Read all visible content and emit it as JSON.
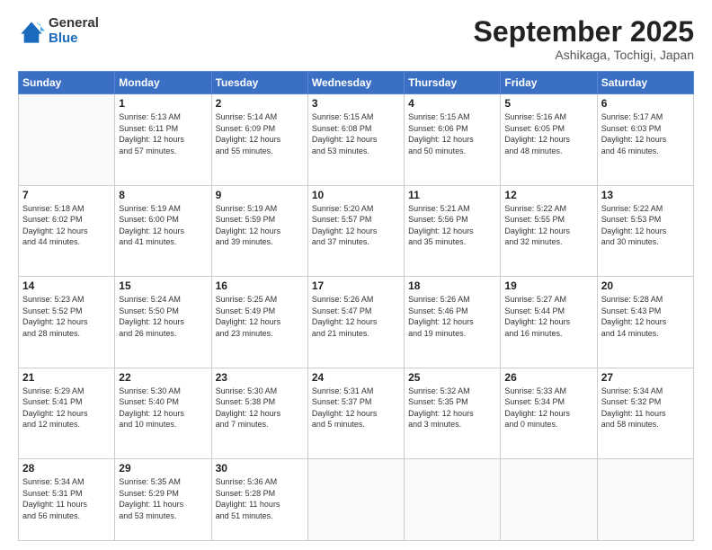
{
  "logo": {
    "general": "General",
    "blue": "Blue"
  },
  "header": {
    "month": "September 2025",
    "location": "Ashikaga, Tochigi, Japan"
  },
  "weekdays": [
    "Sunday",
    "Monday",
    "Tuesday",
    "Wednesday",
    "Thursday",
    "Friday",
    "Saturday"
  ],
  "weeks": [
    [
      {
        "day": "",
        "info": ""
      },
      {
        "day": "1",
        "info": "Sunrise: 5:13 AM\nSunset: 6:11 PM\nDaylight: 12 hours\nand 57 minutes."
      },
      {
        "day": "2",
        "info": "Sunrise: 5:14 AM\nSunset: 6:09 PM\nDaylight: 12 hours\nand 55 minutes."
      },
      {
        "day": "3",
        "info": "Sunrise: 5:15 AM\nSunset: 6:08 PM\nDaylight: 12 hours\nand 53 minutes."
      },
      {
        "day": "4",
        "info": "Sunrise: 5:15 AM\nSunset: 6:06 PM\nDaylight: 12 hours\nand 50 minutes."
      },
      {
        "day": "5",
        "info": "Sunrise: 5:16 AM\nSunset: 6:05 PM\nDaylight: 12 hours\nand 48 minutes."
      },
      {
        "day": "6",
        "info": "Sunrise: 5:17 AM\nSunset: 6:03 PM\nDaylight: 12 hours\nand 46 minutes."
      }
    ],
    [
      {
        "day": "7",
        "info": "Sunrise: 5:18 AM\nSunset: 6:02 PM\nDaylight: 12 hours\nand 44 minutes."
      },
      {
        "day": "8",
        "info": "Sunrise: 5:19 AM\nSunset: 6:00 PM\nDaylight: 12 hours\nand 41 minutes."
      },
      {
        "day": "9",
        "info": "Sunrise: 5:19 AM\nSunset: 5:59 PM\nDaylight: 12 hours\nand 39 minutes."
      },
      {
        "day": "10",
        "info": "Sunrise: 5:20 AM\nSunset: 5:57 PM\nDaylight: 12 hours\nand 37 minutes."
      },
      {
        "day": "11",
        "info": "Sunrise: 5:21 AM\nSunset: 5:56 PM\nDaylight: 12 hours\nand 35 minutes."
      },
      {
        "day": "12",
        "info": "Sunrise: 5:22 AM\nSunset: 5:55 PM\nDaylight: 12 hours\nand 32 minutes."
      },
      {
        "day": "13",
        "info": "Sunrise: 5:22 AM\nSunset: 5:53 PM\nDaylight: 12 hours\nand 30 minutes."
      }
    ],
    [
      {
        "day": "14",
        "info": "Sunrise: 5:23 AM\nSunset: 5:52 PM\nDaylight: 12 hours\nand 28 minutes."
      },
      {
        "day": "15",
        "info": "Sunrise: 5:24 AM\nSunset: 5:50 PM\nDaylight: 12 hours\nand 26 minutes."
      },
      {
        "day": "16",
        "info": "Sunrise: 5:25 AM\nSunset: 5:49 PM\nDaylight: 12 hours\nand 23 minutes."
      },
      {
        "day": "17",
        "info": "Sunrise: 5:26 AM\nSunset: 5:47 PM\nDaylight: 12 hours\nand 21 minutes."
      },
      {
        "day": "18",
        "info": "Sunrise: 5:26 AM\nSunset: 5:46 PM\nDaylight: 12 hours\nand 19 minutes."
      },
      {
        "day": "19",
        "info": "Sunrise: 5:27 AM\nSunset: 5:44 PM\nDaylight: 12 hours\nand 16 minutes."
      },
      {
        "day": "20",
        "info": "Sunrise: 5:28 AM\nSunset: 5:43 PM\nDaylight: 12 hours\nand 14 minutes."
      }
    ],
    [
      {
        "day": "21",
        "info": "Sunrise: 5:29 AM\nSunset: 5:41 PM\nDaylight: 12 hours\nand 12 minutes."
      },
      {
        "day": "22",
        "info": "Sunrise: 5:30 AM\nSunset: 5:40 PM\nDaylight: 12 hours\nand 10 minutes."
      },
      {
        "day": "23",
        "info": "Sunrise: 5:30 AM\nSunset: 5:38 PM\nDaylight: 12 hours\nand 7 minutes."
      },
      {
        "day": "24",
        "info": "Sunrise: 5:31 AM\nSunset: 5:37 PM\nDaylight: 12 hours\nand 5 minutes."
      },
      {
        "day": "25",
        "info": "Sunrise: 5:32 AM\nSunset: 5:35 PM\nDaylight: 12 hours\nand 3 minutes."
      },
      {
        "day": "26",
        "info": "Sunrise: 5:33 AM\nSunset: 5:34 PM\nDaylight: 12 hours\nand 0 minutes."
      },
      {
        "day": "27",
        "info": "Sunrise: 5:34 AM\nSunset: 5:32 PM\nDaylight: 11 hours\nand 58 minutes."
      }
    ],
    [
      {
        "day": "28",
        "info": "Sunrise: 5:34 AM\nSunset: 5:31 PM\nDaylight: 11 hours\nand 56 minutes."
      },
      {
        "day": "29",
        "info": "Sunrise: 5:35 AM\nSunset: 5:29 PM\nDaylight: 11 hours\nand 53 minutes."
      },
      {
        "day": "30",
        "info": "Sunrise: 5:36 AM\nSunset: 5:28 PM\nDaylight: 11 hours\nand 51 minutes."
      },
      {
        "day": "",
        "info": ""
      },
      {
        "day": "",
        "info": ""
      },
      {
        "day": "",
        "info": ""
      },
      {
        "day": "",
        "info": ""
      }
    ]
  ]
}
